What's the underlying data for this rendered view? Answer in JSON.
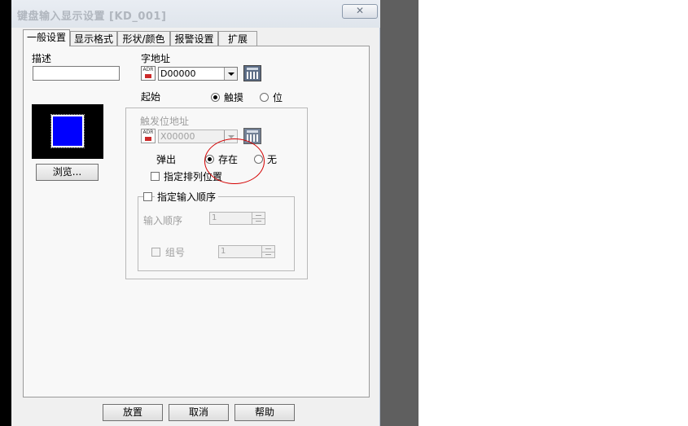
{
  "dialog": {
    "title": "键盘输入显示设置 [KD_001]",
    "close_glyph": "✕"
  },
  "tabs": [
    {
      "label": "一般设置",
      "active": true
    },
    {
      "label": "显示格式",
      "active": false
    },
    {
      "label": "形状/颜色",
      "active": false
    },
    {
      "label": "报警设置",
      "active": false
    },
    {
      "label": "扩展",
      "active": false
    }
  ],
  "general": {
    "description_label": "描述",
    "description_value": "",
    "browse_label": "浏览...",
    "preview_color": "#0000ff",
    "word_address_label": "字地址",
    "word_address_value": "D00000",
    "start_label": "起始",
    "start_options": [
      {
        "label": "触摸",
        "checked": true
      },
      {
        "label": "位",
        "checked": false
      }
    ],
    "trigger_bit_label": "触发位地址",
    "trigger_bit_value": "X00000",
    "popup_label": "弹出",
    "popup_options": [
      {
        "label": "存在",
        "checked": true
      },
      {
        "label": "无",
        "checked": false
      }
    ],
    "specify_position_label": "指定排列位置",
    "specify_order_label": "指定输入顺序",
    "input_order_label": "输入顺序",
    "input_order_value": "1",
    "group_no_label": "组号",
    "group_no_value": "1"
  },
  "footer": {
    "ok_label": "放置",
    "cancel_label": "取消",
    "help_label": "帮助"
  },
  "icons": [
    "address-pick-icon",
    "calculator-icon",
    "close-icon"
  ],
  "colors": {
    "annotation": "#d40000",
    "preview_bg": "#000000"
  }
}
